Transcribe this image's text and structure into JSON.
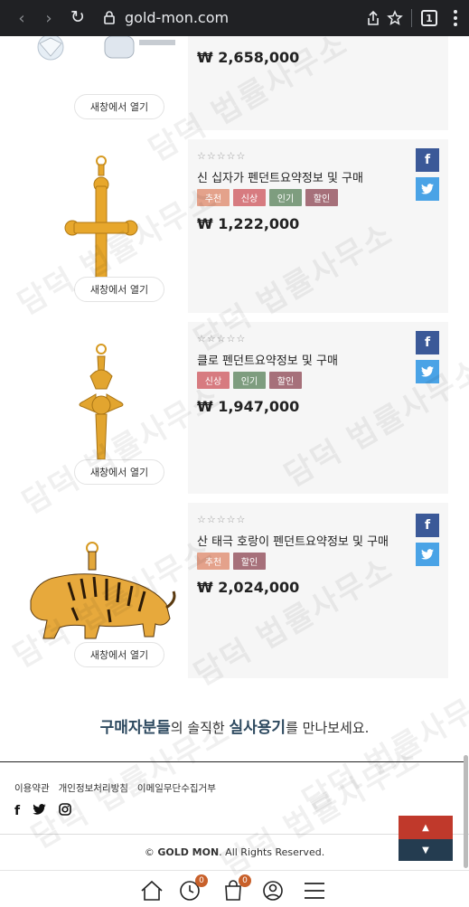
{
  "browser": {
    "url": "gold-mon.com",
    "tab_count": "1"
  },
  "watermark": "담덕 법률사무소",
  "open_label": "새창에서 열기",
  "products": [
    {
      "name": "",
      "price": "₩ 2,658,000",
      "tags": []
    },
    {
      "name": "신 십자가 펜던트요약정보 및 구매",
      "price": "₩ 1,222,000",
      "stars": "☆☆☆☆☆",
      "tags": [
        "추천",
        "신상",
        "인기",
        "할인"
      ]
    },
    {
      "name": "클로 펜던트요약정보 및 구매",
      "price": "₩ 1,947,000",
      "stars": "☆☆☆☆☆",
      "tags": [
        "신상",
        "인기",
        "할인"
      ]
    },
    {
      "name": "산 태극 호랑이 펜던트요약정보 및 구매",
      "price": "₩ 2,024,000",
      "stars": "☆☆☆☆☆",
      "tags": [
        "추천",
        "할인"
      ]
    }
  ],
  "review": {
    "part1": "구매자분들",
    "part2": "의 솔직한 ",
    "part3": "실사용기",
    "part4": "를 만나보세요."
  },
  "footer": {
    "links": [
      "이용약관",
      "개인정보처리방침",
      "이메일무단수집거부"
    ],
    "copyright_brand": "GOLD MON",
    "copyright_text": ". All Rights Reserved.",
    "copyright_symbol": "©"
  },
  "bottom_nav": {
    "recent_count": "0",
    "cart_count": "0"
  },
  "colors": {
    "facebook": "#3b5998",
    "twitter": "#4aa3e6",
    "to_top": "#c0392b",
    "to_bottom": "#243c50"
  }
}
